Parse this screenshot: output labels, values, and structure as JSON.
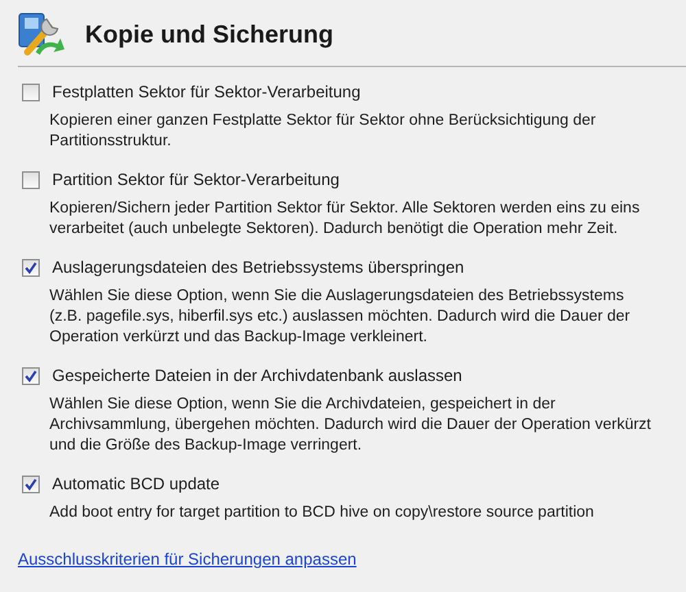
{
  "header": {
    "title": "Kopie und Sicherung"
  },
  "options": [
    {
      "label": "Festplatten Sektor für Sektor-Verarbeitung",
      "checked": false,
      "description": "Kopieren einer ganzen Festplatte Sektor für Sektor ohne Berücksichtigung der Partitionsstruktur."
    },
    {
      "label": "Partition Sektor für Sektor-Verarbeitung",
      "checked": false,
      "description": "Kopieren/Sichern jeder Partition Sektor für Sektor. Alle Sektoren werden eins zu eins verarbeitet (auch unbelegte Sektoren). Dadurch benötigt die Operation mehr Zeit."
    },
    {
      "label": "Auslagerungsdateien des Betriebssystems überspringen",
      "checked": true,
      "description": "Wählen Sie diese Option, wenn Sie die Auslagerungsdateien des Betriebssystems (z.B. pagefile.sys, hiberfil.sys etc.) auslassen möchten. Dadurch wird die Dauer der Operation verkürzt und das Backup-Image verkleinert."
    },
    {
      "label": "Gespeicherte Dateien in der Archivdatenbank auslassen",
      "checked": true,
      "description": "Wählen Sie diese Option, wenn Sie die Archivdateien, gespeichert in der Archivsammlung, übergehen möchten. Dadurch wird die Dauer der Operation verkürzt und die Größe des Backup-Image verringert."
    },
    {
      "label": "Automatic BCD update",
      "checked": true,
      "description": "Add boot entry for target partition to BCD hive on copy\\restore source partition"
    }
  ],
  "link": "Ausschlusskriterien für Sicherungen anpassen"
}
